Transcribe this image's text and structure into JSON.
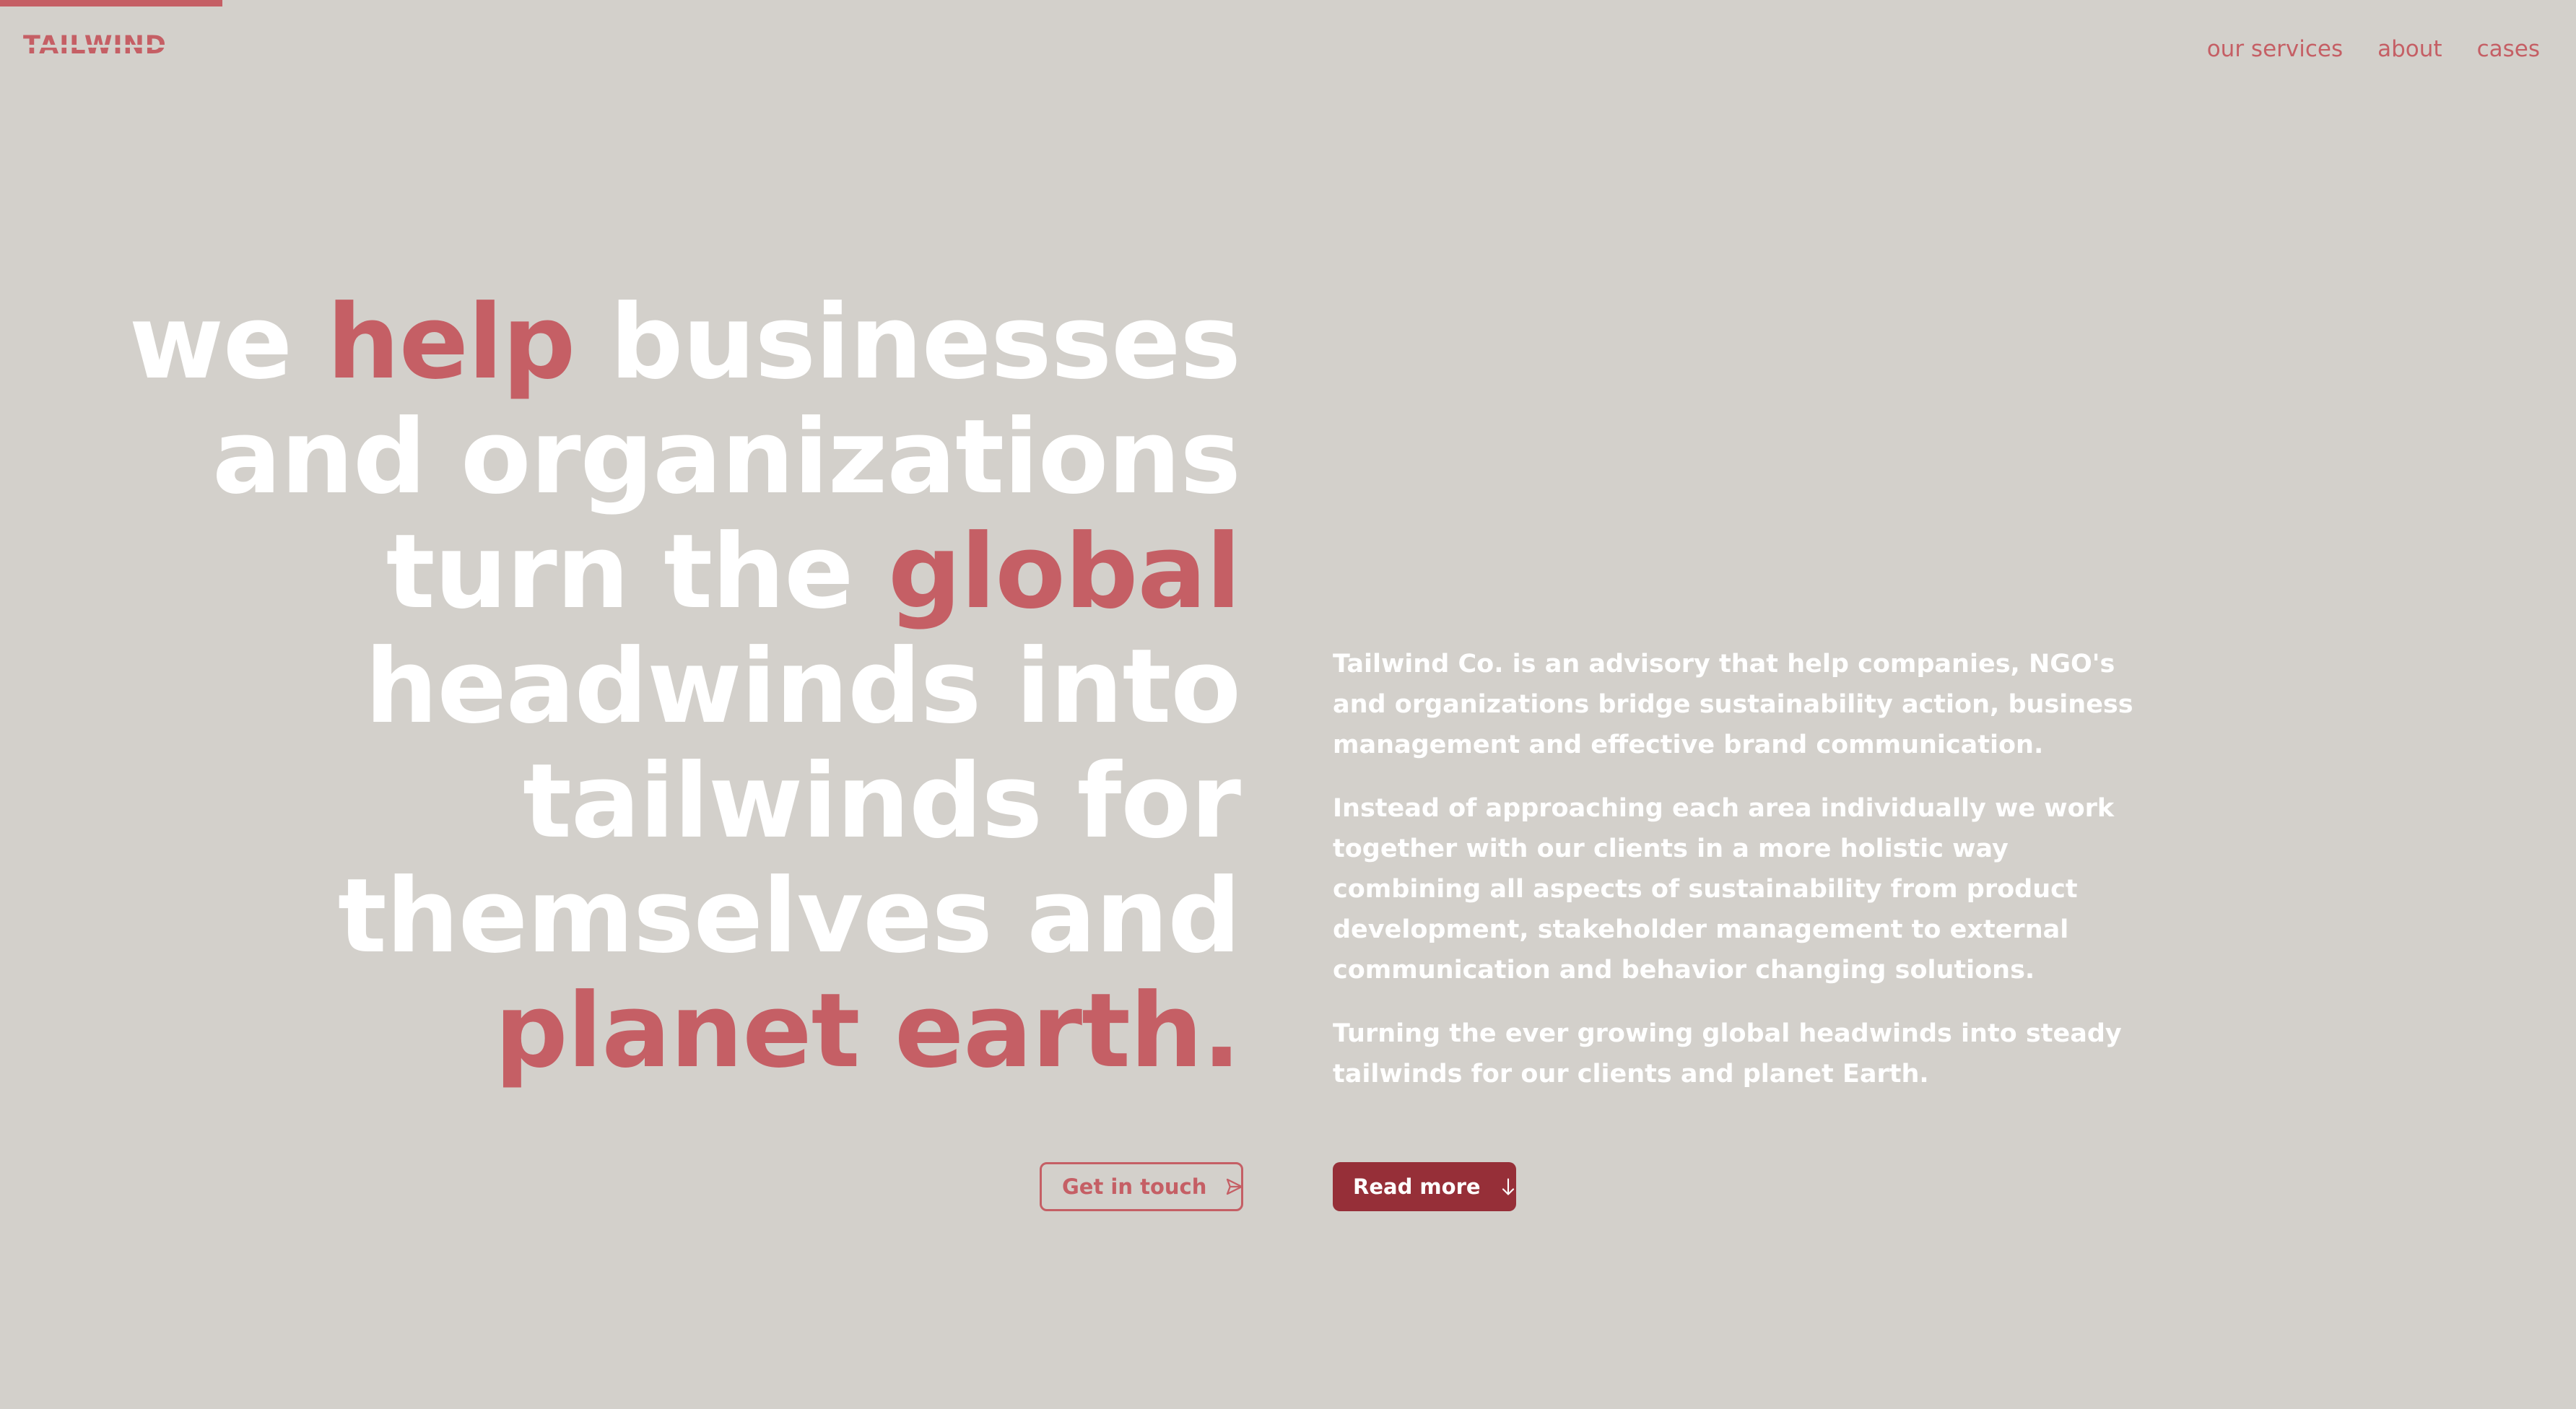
{
  "logo": {
    "text": "TAILWIND"
  },
  "nav": {
    "items": [
      {
        "label": "our services"
      },
      {
        "label": "about"
      },
      {
        "label": "cases"
      }
    ]
  },
  "hero": {
    "headline": {
      "line1_a": "we ",
      "line1_accent": "help",
      "line1_b": " businesses",
      "line2": "and organizations",
      "line3_a": "turn the ",
      "line3_accent": "global",
      "line4": "headwinds into",
      "line5": "tailwinds for",
      "line6": "themselves and",
      "line7_accent": "planet earth."
    },
    "paragraphs": [
      "Tailwind Co. is an advisory that help companies, NGO's and organizations bridge sustainability action, business management and effective brand communication.",
      "Instead of approaching each area individually we work together with our clients in a more holistic way combining all aspects of sustainability from product development, stakeholder management to external communication and behavior changing solutions.",
      "Turning the ever growing global headwinds into steady tailwinds for our clients and planet Earth."
    ],
    "cta": {
      "get_in_touch": "Get in touch",
      "read_more": "Read more"
    }
  },
  "icons": {
    "send": "send-icon",
    "arrow_down": "arrow-down-icon"
  },
  "colors": {
    "background": "#d3d0cb",
    "accent": "#c55f65",
    "accent_dark": "#962f38",
    "text_light": "#ffffff"
  }
}
